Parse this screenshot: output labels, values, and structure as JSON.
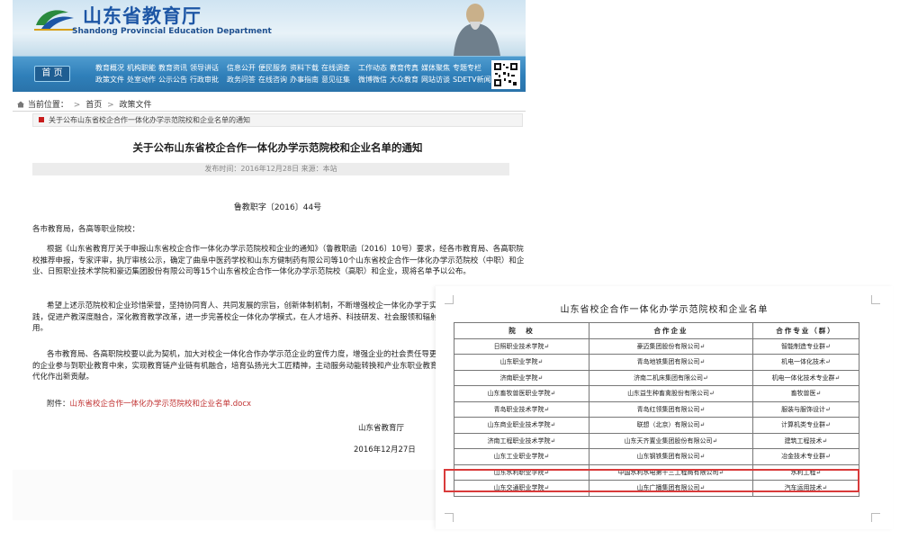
{
  "header": {
    "site_name": "山东省教育厅",
    "site_name_en": "Shandong Provincial Education Department",
    "home_label": "首 页",
    "nav_groups": [
      [
        "教育概况",
        "机构职能",
        "教育资讯",
        "领导讲话",
        "政策文件",
        "处室动作",
        "公示公告",
        "行政审批"
      ],
      [
        "信息公开",
        "便民服务",
        "资料下载",
        "在线调查",
        "政务问答",
        "在线咨询",
        "办事指南",
        "意见征集"
      ],
      [
        "工作动态",
        "教育传真",
        "媒体聚焦",
        "专题专栏",
        "微博微信",
        "大众教育",
        "网站访谈",
        "SDETV新闻"
      ]
    ]
  },
  "breadcrumb": {
    "prefix": "当前位置：",
    "home": "首页",
    "sep": ">",
    "current": "政策文件"
  },
  "article": {
    "notice": "关于公布山东省校企合作一体化办学示范院校和企业名单的通知",
    "title": "关于公布山东省校企合作一体化办学示范院校和企业名单的通知",
    "meta": "发布时间：2016年12月28日 来源：本站",
    "doc_number": "鲁教职字〔2016〕44号",
    "salutation": "各市教育局，各高等职业院校：",
    "paragraph1": "根据《山东省教育厅关于申报山东省校企合作一体化办学示范院校和企业的通知》（鲁教职函〔2016〕10号）要求，经各市教育局、各高职院校推荐申报，专家评审，执厅审核公示，确定了曲阜中医药学校和山东方健制药有限公司等10个山东省校企合作一体化办学示范院校（中职）和企业、日照职业技术学院和豪迈集团股份有限公司等15个山东省校企合作一体化办学示范院校（高职）和企业，现将名单予以公布。",
    "paragraph2": "希望上述示范院校和企业珍惜荣誉，坚持协同育人、共同发展的宗旨，创新体制机制，不断增强校企一体化办学于实践，促进产教深度融合，深化教育教学改革，进一步完善校企一体化办学模式，在人才培养、科技研发、社会服领和辐射作用。",
    "paragraph3": "各市教育局、各高职院校要以此为契机，加大对校企一体化合作办学示范企业的宣传力度，增强企业的社会责任导更多的企业参与到职业教育中来，实现教育链产业链有机融合，培育弘扬光大工匠精神，主动服务动能转换和产业东职业教育现代化作出新贡献。",
    "attachment_label": "附件：",
    "attachment_link": "山东省校企合作一体化办学示范院校和企业名单.docx",
    "signature_org": "山东省教育厅",
    "signature_date": "2016年12月27日"
  },
  "overlay": {
    "title": "山东省校企合作一体化办学示范院校和企业名单",
    "columns": [
      "院　校",
      "合作企业",
      "合作专业（群）"
    ],
    "rows": [
      [
        "日照职业技术学院↵",
        "豪迈集团股份有限公司↵",
        "智能制造专业群↵"
      ],
      [
        "山东职业学院↵",
        "青岛地铁集团有限公司↵",
        "机电一体化技术↵"
      ],
      [
        "济南职业学院↵",
        "济南二机床集团有限公司↵",
        "机电一体化技术专业群↵"
      ],
      [
        "山东畜牧兽医职业学院↵",
        "山东益生种畜禽股份有限公司↵",
        "畜牧兽医↵"
      ],
      [
        "青岛职业技术学院↵",
        "青岛红领集团有限公司↵",
        "服装与服饰设计↵"
      ],
      [
        "山东商业职业技术学院↵",
        "联想（北京）有限公司↵",
        "计算机类专业群↵"
      ],
      [
        "济南工程职业技术学院↵",
        "山东天齐置业集团股份有限公司↵",
        "建筑工程技术↵"
      ],
      [
        "山东工业职业学院↵",
        "山东钢铁集团有限公司↵",
        "冶金技术专业群↵"
      ],
      [
        "山东水利职业学院↵",
        "中国水利水电第十三工程局有限公司↵",
        "水利工程↵"
      ],
      [
        "山东交通职业学院↵",
        "山东广播集团有限公司↵",
        "汽车运用技术↵"
      ]
    ],
    "highlight_color": "#d93a3a"
  },
  "colors": {
    "nav_blue": "#2f7fb9",
    "brand_blue": "#1d56a5",
    "link_red": "#c03030"
  }
}
